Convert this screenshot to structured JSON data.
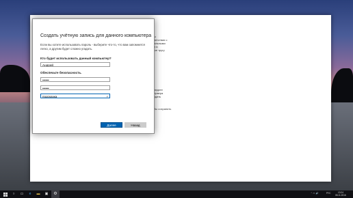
{
  "background_window": {
    "fragments": [
      "ы",
      "ветствии с",
      "альными",
      "и в",
      "ые тругу",
      "ведите",
      "ервера",
      "здать",
      "бы сохранить"
    ]
  },
  "dialog": {
    "title": "Создать учётную запись для данного компьютера",
    "description": "Если вы хотите использовать пароль - выберите что-то, что вам запомнится легко, а другим будет сложно угадать.",
    "who_label": "Кто будет использовать данный компьютер?",
    "username_value": "Андрей",
    "security_label": "Обеспечьте безопасность.",
    "password_value": "••••••",
    "password_confirm_value": "••••••",
    "hint_value": "подсказка",
    "clear_icon": "×",
    "next_label": "Далее",
    "back_label": "Назад"
  },
  "taskbar": {
    "start_icon": "windows-logo",
    "search_icon": "search-icon",
    "tray_icons": "⌃ ▭ 🔊",
    "language": "РУС",
    "time": "13:24",
    "date": "08.11.2016"
  },
  "colors": {
    "accent": "#0063b1",
    "taskbar": "#101014"
  }
}
